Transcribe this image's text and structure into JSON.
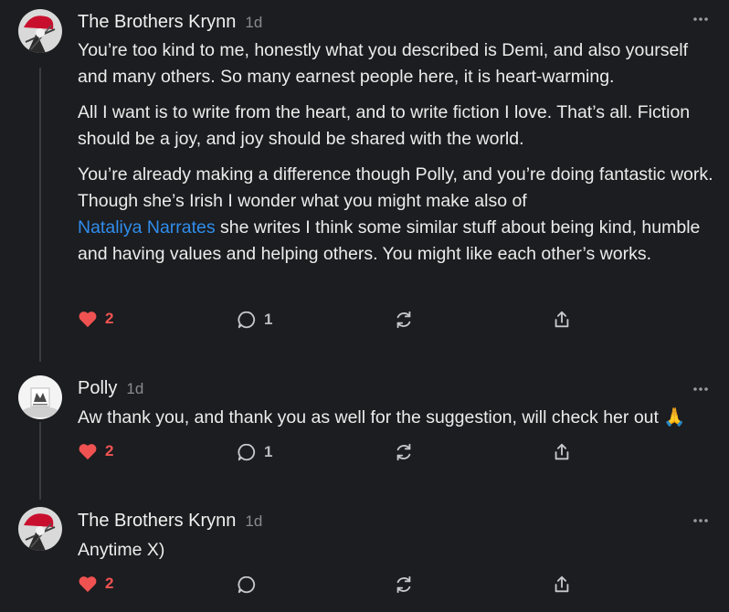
{
  "colors": {
    "background": "#1c1d20",
    "link": "#2f8ded",
    "heart": "#f05252",
    "muted": "#8a8b90"
  },
  "comments": [
    {
      "author": "The Brothers Krynn",
      "time": "1d",
      "paragraphs": [
        "You’re too kind to me, honestly what you described is Demi, and also yourself and many others. So many earnest people here, it is heart-warming.",
        "All I want is to write from the heart, and to write fiction I love. That’s all. Fiction should be a joy, and joy should be shared with the world."
      ],
      "p3_before": "You’re already making a difference though Polly, and you’re doing fantastic work. Though she’s Irish I wonder what you might make also of",
      "p3_link": "Nataliya Narrates",
      "p3_after": " she writes I think some similar stuff about being kind, humble and having values and helping others. You might like each other’s works.",
      "likes": "2",
      "replies": "1"
    },
    {
      "author": "Polly",
      "time": "1d",
      "text": "Aw thank you, and thank you as well for the suggestion, will check her out 🙏",
      "likes": "2",
      "replies": "1"
    },
    {
      "author": "The Brothers Krynn",
      "time": "1d",
      "text": "Anytime X)",
      "likes": "2"
    }
  ]
}
